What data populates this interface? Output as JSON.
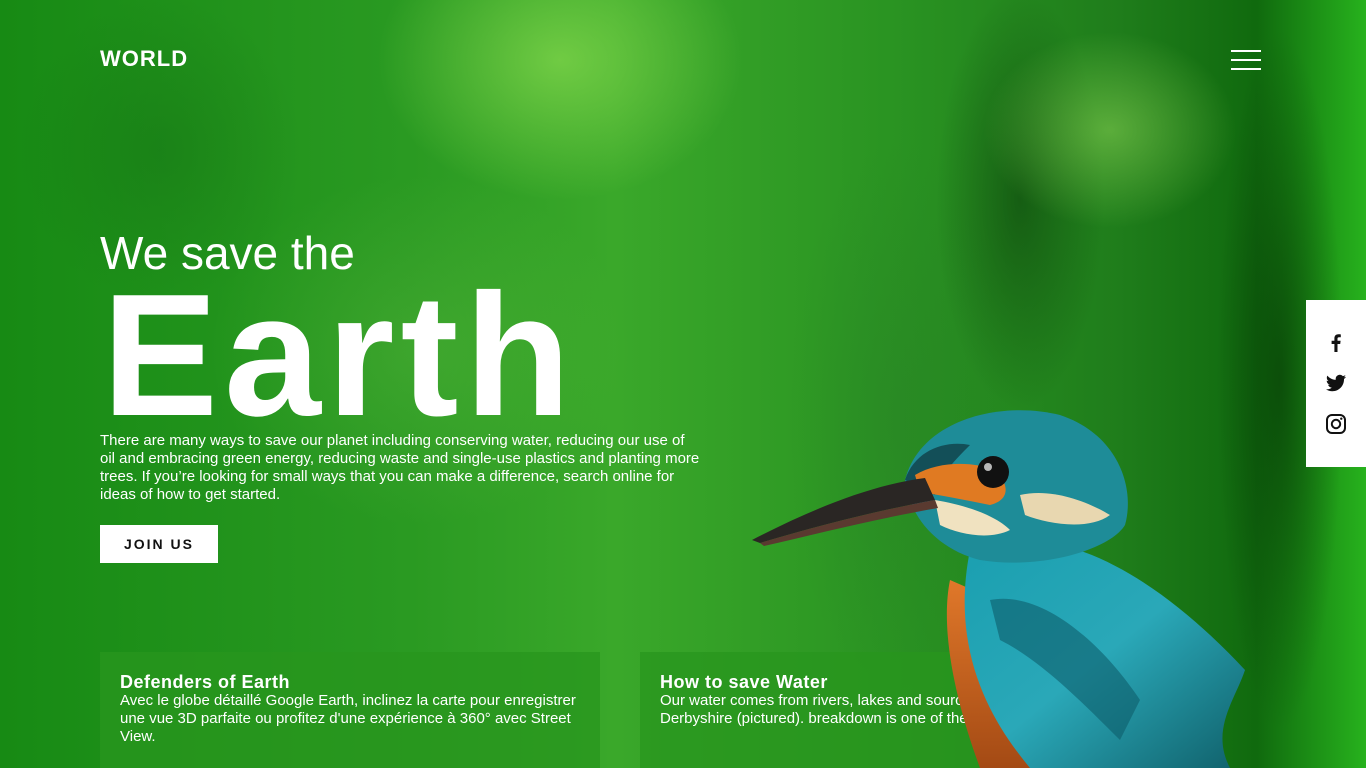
{
  "brand": {
    "logo": "WORLD"
  },
  "nav": {
    "menu_icon": "hamburger-menu-icon"
  },
  "hero": {
    "subtitle": "We save the",
    "title": "Earth",
    "intro": "There are many ways to save our planet including conserving water, reducing our use of oil and embracing green energy, reducing waste and single-use plastics and planting more trees. If you’re looking for small ways that you can make a difference, search online for ideas of how to get started.",
    "cta_label": "JOIN US"
  },
  "cards": [
    {
      "title": "Defenders of Earth",
      "text": "Avec le globe détaillé Google Earth, inclinez la carte pour enregistrer une vue 3D parfaite ou profitez d'une expérience à 360° avec Street View."
    },
    {
      "title": "How to save Water",
      "text": "Our water comes from rivers, lakes and source Ladybower Reservoir in Derbyshire (pictured). breakdown is one of the biggest drivers"
    }
  ],
  "social": {
    "icons": [
      "facebook-icon",
      "twitter-icon",
      "instagram-icon"
    ]
  },
  "colors": {
    "background": "#1e8a1c",
    "card_bg": "#28961e",
    "text": "#ffffff",
    "button_bg": "#ffffff",
    "button_text": "#111111"
  }
}
